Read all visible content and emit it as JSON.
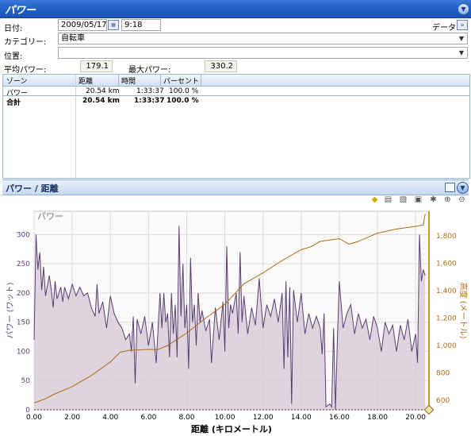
{
  "window": {
    "title": "パワー"
  },
  "header": {
    "date_label": "日付:",
    "date_value": "2009/05/17",
    "time_value": "9:18",
    "data_label": "データ",
    "category_label": "カテゴリー:",
    "category_value": "自転車",
    "location_label": "位置:",
    "location_value": "",
    "avg_power_label": "平均パワー:",
    "avg_power_value": "179.1",
    "max_power_label": "最大パワー:",
    "max_power_value": "330.2"
  },
  "table": {
    "columns": [
      "ゾーン",
      "距離",
      "時間",
      "パーセント"
    ],
    "rows": [
      [
        "パワー",
        "20.54 km",
        "1:33:37",
        "100.0 %"
      ],
      [
        "合計",
        "20.54 km",
        "1:33:37",
        "100.0 %"
      ]
    ]
  },
  "panel": {
    "title": "パワー / 距離"
  },
  "icons": [
    "expand-icon",
    "collapse-icon",
    "panel-layout-icon",
    "diamond-marker-icon",
    "list-view-icon",
    "chart-view-icon",
    "save-icon",
    "settings-icon",
    "zoom-in-icon",
    "zoom-out-icon",
    "calendar-icon",
    "data-icon"
  ],
  "colors": {
    "power_line": "#5b3e74",
    "power_fill": "#d8ccd8",
    "elevation_line": "#b06c18",
    "left_axis_text": "#5b3e74",
    "right_axis_text": "#b06c18",
    "titlebar": "#2a66cc"
  },
  "chart_data": {
    "type": "area",
    "title": "パワー",
    "xlabel": "距離 (キロメートル)",
    "ylabel": "パワー (ワット)",
    "y2label": "高度 (メートル)",
    "xlim": [
      0,
      20.7
    ],
    "ylim": [
      0,
      340
    ],
    "y2lim": [
      530,
      1980
    ],
    "x_ticks": [
      "0.00",
      "2.00",
      "4.00",
      "6.00",
      "8.00",
      "10.00",
      "12.00",
      "14.00",
      "16.00",
      "18.00",
      "20.00"
    ],
    "y_ticks": [
      "0",
      "50",
      "100",
      "150",
      "200",
      "250",
      "300"
    ],
    "y2_ticks": [
      "600",
      "800",
      "1,000",
      "1,200",
      "1,400",
      "1,600",
      "1,800"
    ],
    "grid": true,
    "series": [
      {
        "name": "パワー",
        "axis": "left",
        "points": [
          [
            0.0,
            120
          ],
          [
            0.1,
            300
          ],
          [
            0.2,
            240
          ],
          [
            0.3,
            270
          ],
          [
            0.4,
            205
          ],
          [
            0.5,
            245
          ],
          [
            0.6,
            195
          ],
          [
            0.8,
            230
          ],
          [
            0.9,
            205
          ],
          [
            1.0,
            175
          ],
          [
            1.1,
            220
          ],
          [
            1.2,
            190
          ],
          [
            1.4,
            210
          ],
          [
            1.5,
            185
          ],
          [
            1.6,
            210
          ],
          [
            1.8,
            190
          ],
          [
            2.0,
            215
          ],
          [
            2.2,
            195
          ],
          [
            2.4,
            210
          ],
          [
            2.6,
            195
          ],
          [
            2.8,
            200
          ],
          [
            3.0,
            175
          ],
          [
            3.2,
            160
          ],
          [
            3.3,
            215
          ],
          [
            3.4,
            165
          ],
          [
            3.6,
            185
          ],
          [
            3.8,
            140
          ],
          [
            4.0,
            195
          ],
          [
            4.2,
            165
          ],
          [
            4.4,
            150
          ],
          [
            4.6,
            140
          ],
          [
            4.8,
            120
          ],
          [
            5.0,
            130
          ],
          [
            5.1,
            100
          ],
          [
            5.2,
            160
          ],
          [
            5.3,
            45
          ],
          [
            5.4,
            155
          ],
          [
            5.6,
            130
          ],
          [
            5.8,
            160
          ],
          [
            6.0,
            110
          ],
          [
            6.2,
            150
          ],
          [
            6.4,
            80
          ],
          [
            6.6,
            200
          ],
          [
            6.7,
            140
          ],
          [
            6.8,
            200
          ],
          [
            6.9,
            150
          ],
          [
            7.0,
            165
          ],
          [
            7.1,
            90
          ],
          [
            7.2,
            200
          ],
          [
            7.3,
            130
          ],
          [
            7.4,
            180
          ],
          [
            7.5,
            90
          ],
          [
            7.6,
            315
          ],
          [
            7.7,
            160
          ],
          [
            7.8,
            250
          ],
          [
            7.9,
            140
          ],
          [
            8.0,
            180
          ],
          [
            8.1,
            70
          ],
          [
            8.2,
            260
          ],
          [
            8.3,
            150
          ],
          [
            8.4,
            180
          ],
          [
            8.5,
            110
          ],
          [
            8.6,
            200
          ],
          [
            8.7,
            150
          ],
          [
            8.8,
            170
          ],
          [
            9.0,
            135
          ],
          [
            9.2,
            155
          ],
          [
            9.3,
            80
          ],
          [
            9.5,
            175
          ],
          [
            9.7,
            120
          ],
          [
            9.9,
            185
          ],
          [
            10.0,
            100
          ],
          [
            10.1,
            280
          ],
          [
            10.2,
            140
          ],
          [
            10.3,
            180
          ],
          [
            10.4,
            165
          ],
          [
            10.6,
            200
          ],
          [
            10.7,
            130
          ],
          [
            10.8,
            270
          ],
          [
            10.9,
            150
          ],
          [
            11.0,
            195
          ],
          [
            11.2,
            130
          ],
          [
            11.4,
            175
          ],
          [
            11.6,
            145
          ],
          [
            11.8,
            225
          ],
          [
            12.0,
            140
          ],
          [
            12.2,
            180
          ],
          [
            12.4,
            160
          ],
          [
            12.6,
            190
          ],
          [
            12.8,
            150
          ],
          [
            13.0,
            200
          ],
          [
            13.1,
            70
          ],
          [
            13.2,
            220
          ],
          [
            13.3,
            90
          ],
          [
            13.4,
            210
          ],
          [
            13.5,
            10
          ],
          [
            13.6,
            205
          ],
          [
            13.8,
            150
          ],
          [
            14.0,
            200
          ],
          [
            14.2,
            130
          ],
          [
            14.4,
            165
          ],
          [
            14.6,
            140
          ],
          [
            14.8,
            160
          ],
          [
            15.0,
            140
          ],
          [
            15.1,
            95
          ],
          [
            15.2,
            165
          ],
          [
            15.3,
            5
          ],
          [
            15.5,
            10
          ],
          [
            15.6,
            5
          ],
          [
            15.7,
            140
          ],
          [
            15.8,
            0
          ],
          [
            15.9,
            120
          ],
          [
            16.0,
            220
          ],
          [
            16.2,
            140
          ],
          [
            16.4,
            165
          ],
          [
            16.6,
            180
          ],
          [
            16.8,
            130
          ],
          [
            17.0,
            165
          ],
          [
            17.2,
            140
          ],
          [
            17.4,
            155
          ],
          [
            17.6,
            120
          ],
          [
            17.8,
            160
          ],
          [
            18.0,
            140
          ],
          [
            18.2,
            100
          ],
          [
            18.4,
            150
          ],
          [
            18.6,
            130
          ],
          [
            18.8,
            145
          ],
          [
            19.0,
            100
          ],
          [
            19.2,
            145
          ],
          [
            19.4,
            120
          ],
          [
            19.6,
            155
          ],
          [
            19.8,
            100
          ],
          [
            20.0,
            130
          ],
          [
            20.1,
            80
          ],
          [
            20.2,
            300
          ],
          [
            20.3,
            220
          ],
          [
            20.4,
            240
          ],
          [
            20.5,
            230
          ]
        ]
      },
      {
        "name": "高度",
        "axis": "right",
        "points": [
          [
            0.0,
            580
          ],
          [
            0.5,
            605
          ],
          [
            1.0,
            640
          ],
          [
            2.0,
            700
          ],
          [
            3.0,
            780
          ],
          [
            3.5,
            830
          ],
          [
            4.0,
            880
          ],
          [
            4.5,
            950
          ],
          [
            5.0,
            965
          ],
          [
            6.0,
            970
          ],
          [
            6.5,
            970
          ],
          [
            7.0,
            1000
          ],
          [
            8.0,
            1090
          ],
          [
            9.0,
            1200
          ],
          [
            10.0,
            1300
          ],
          [
            11.0,
            1450
          ],
          [
            12.0,
            1530
          ],
          [
            13.0,
            1620
          ],
          [
            14.0,
            1700
          ],
          [
            14.5,
            1720
          ],
          [
            15.0,
            1760
          ],
          [
            16.0,
            1780
          ],
          [
            16.5,
            1740
          ],
          [
            17.0,
            1760
          ],
          [
            18.0,
            1820
          ],
          [
            19.0,
            1850
          ],
          [
            20.0,
            1870
          ],
          [
            20.4,
            1880
          ],
          [
            20.5,
            1960
          ]
        ]
      }
    ]
  }
}
